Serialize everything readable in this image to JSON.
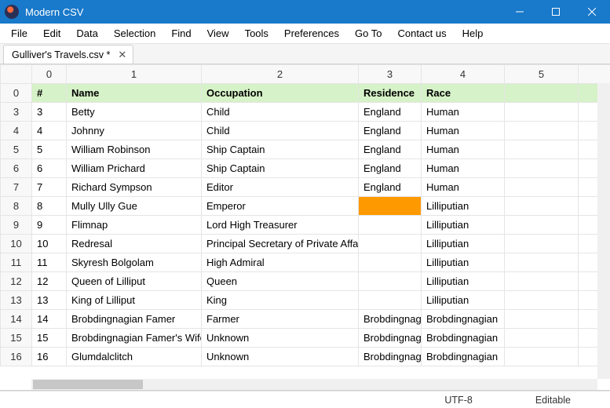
{
  "window": {
    "title": "Modern CSV"
  },
  "menu": [
    "File",
    "Edit",
    "Data",
    "Selection",
    "Find",
    "View",
    "Tools",
    "Preferences",
    "Go To",
    "Contact us",
    "Help"
  ],
  "tab": {
    "label": "Gulliver's Travels.csv *"
  },
  "colHeaders": [
    "0",
    "1",
    "2",
    "3",
    "4",
    "5",
    ""
  ],
  "rows": [
    {
      "rh": "0",
      "cells": [
        "#",
        "Name",
        "Occupation",
        "Residence",
        "Race",
        "",
        ""
      ],
      "isHeader": true
    },
    {
      "rh": "3",
      "cells": [
        "3",
        "Betty",
        "Child",
        "England",
        "Human",
        "",
        ""
      ]
    },
    {
      "rh": "4",
      "cells": [
        "4",
        "Johnny",
        "Child",
        "England",
        "Human",
        "",
        ""
      ]
    },
    {
      "rh": "5",
      "cells": [
        "5",
        "William Robinson",
        "Ship Captain",
        "England",
        "Human",
        "",
        ""
      ]
    },
    {
      "rh": "6",
      "cells": [
        "6",
        "William Prichard",
        "Ship Captain",
        "England",
        "Human",
        "",
        ""
      ]
    },
    {
      "rh": "7",
      "cells": [
        "7",
        "Richard Sympson",
        "Editor",
        "England",
        "Human",
        "",
        ""
      ]
    },
    {
      "rh": "8",
      "cells": [
        "8",
        "Mully Ully Gue",
        "Emperor",
        "",
        "Lilliputian",
        "",
        ""
      ],
      "highlightCol": 3
    },
    {
      "rh": "9",
      "cells": [
        "9",
        "Flimnap",
        "Lord High Treasurer",
        "",
        "Lilliputian",
        "",
        ""
      ]
    },
    {
      "rh": "10",
      "cells": [
        "10",
        "Redresal",
        "Principal Secretary of Private Affairs",
        "",
        "Lilliputian",
        "",
        ""
      ]
    },
    {
      "rh": "11",
      "cells": [
        "11",
        "Skyresh Bolgolam",
        "High Admiral",
        "",
        "Lilliputian",
        "",
        ""
      ]
    },
    {
      "rh": "12",
      "cells": [
        "12",
        "Queen of Lilliput",
        "Queen",
        "",
        "Lilliputian",
        "",
        ""
      ]
    },
    {
      "rh": "13",
      "cells": [
        "13",
        "King of Lilliput",
        "King",
        "",
        "Lilliputian",
        "",
        ""
      ]
    },
    {
      "rh": "14",
      "cells": [
        "14",
        "Brobdingnagian Famer",
        "Farmer",
        "Brobdingnag",
        "Brobdingnagian",
        "",
        ""
      ]
    },
    {
      "rh": "15",
      "cells": [
        "15",
        "Brobdingnagian Famer's Wife",
        "Unknown",
        "Brobdingnag",
        "Brobdingnagian",
        "",
        ""
      ]
    },
    {
      "rh": "16",
      "cells": [
        "16",
        "Glumdalclitch",
        "Unknown",
        "Brobdingnag",
        "Brobdingnagian",
        "",
        ""
      ]
    }
  ],
  "status": {
    "encoding": "UTF-8",
    "mode": "Editable"
  }
}
